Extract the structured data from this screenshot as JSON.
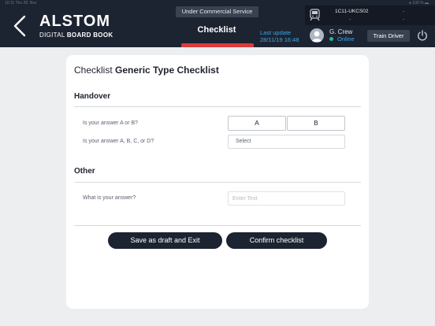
{
  "status_bar": {
    "left": "10:11  Thu 28. Nov",
    "right": "● 100 % ▬"
  },
  "header": {
    "logo": "ALSTOM",
    "logo_sub_plain": "DIGITAL ",
    "logo_sub_bold": "BOARD BOOK",
    "service_status": "Under Commercial Service",
    "title": "Checklist",
    "last_update_label": "Last update",
    "last_update_value": "28/11/19 16:48",
    "train_id": "1C11-UKCS02",
    "train_dash": "-",
    "user_name": "G. Crew",
    "user_status": "Online",
    "role": "Train Driver",
    "icons": [
      "back-chevron-icon",
      "train-icon",
      "avatar-icon",
      "power-icon"
    ]
  },
  "card": {
    "title_prefix": "Checklist ",
    "title_name": "Generic Type Checklist",
    "sections": [
      {
        "title": "Handover",
        "questions": [
          {
            "text": "Is your answer A or B?",
            "options": [
              "A",
              "B"
            ]
          },
          {
            "text": "Is your answer A, B, C, or D?",
            "select_value": "Select"
          }
        ]
      },
      {
        "title": "Other",
        "questions": [
          {
            "text": "What is your answer?",
            "placeholder": "Enter Text"
          }
        ]
      }
    ],
    "save_draft_label": "Save as draft and Exit",
    "confirm_label": "Confirm checklist"
  },
  "colors": {
    "header_bg": "#1c2331",
    "accent_red": "#d93a3a",
    "accent_blue": "#3ea7e6",
    "online_green": "#2fb6a5",
    "button_dark": "#1c2331"
  }
}
